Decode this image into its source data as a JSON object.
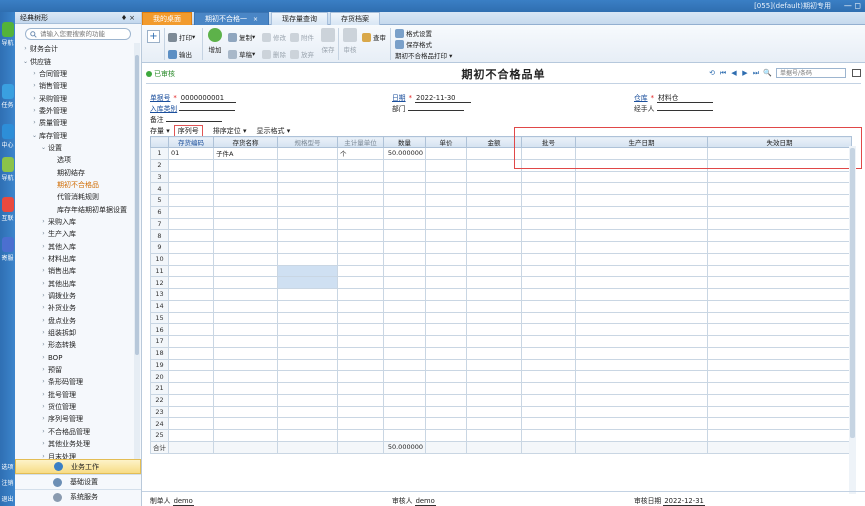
{
  "titlebar": {
    "title": "[055](default)期初专用",
    "controls": "— ◻"
  },
  "rail": [
    {
      "label": "导航",
      "color": "#53b33a"
    },
    {
      "label": "任务",
      "color": "#3aa0e0"
    },
    {
      "label": "中心",
      "color": "#2d8ed8"
    },
    {
      "label": "导航",
      "color": "#8bc34a"
    },
    {
      "label": "互联",
      "color": "#e94a3f"
    },
    {
      "label": "寄服",
      "color": "#4b6fd0"
    },
    {
      "label": "选项",
      "color": ""
    },
    {
      "label": "注销",
      "color": ""
    },
    {
      "label": "退出",
      "color": ""
    }
  ],
  "sidebar": {
    "title": "经典树形",
    "pin": "♦",
    "close": "×",
    "search_placeholder": "请输入您要搜索的功能",
    "tree": [
      {
        "label": "财务会计",
        "level": 0,
        "arrow": "›",
        "active": false
      },
      {
        "label": "供应链",
        "level": 0,
        "arrow": "⌄",
        "active": false
      },
      {
        "label": "合同管理",
        "level": 1,
        "arrow": "›",
        "active": false
      },
      {
        "label": "销售管理",
        "level": 1,
        "arrow": "›",
        "active": false
      },
      {
        "label": "采购管理",
        "level": 1,
        "arrow": "›",
        "active": false
      },
      {
        "label": "委外管理",
        "level": 1,
        "arrow": "›",
        "active": false
      },
      {
        "label": "质量管理",
        "level": 1,
        "arrow": "›",
        "active": false
      },
      {
        "label": "库存管理",
        "level": 1,
        "arrow": "⌄",
        "active": false
      },
      {
        "label": "设置",
        "level": 2,
        "arrow": "⌄",
        "active": false
      },
      {
        "label": "选项",
        "level": 3,
        "arrow": "",
        "active": false
      },
      {
        "label": "期初结存",
        "level": 3,
        "arrow": "",
        "active": false
      },
      {
        "label": "期初不合格品",
        "level": 3,
        "arrow": "",
        "active": true
      },
      {
        "label": "代管消耗规则",
        "level": 3,
        "arrow": "",
        "active": false
      },
      {
        "label": "库存年结期初单据设置",
        "level": 3,
        "arrow": "",
        "active": false
      },
      {
        "label": "采购入库",
        "level": 2,
        "arrow": "›",
        "active": false
      },
      {
        "label": "生产入库",
        "level": 2,
        "arrow": "›",
        "active": false
      },
      {
        "label": "其他入库",
        "level": 2,
        "arrow": "›",
        "active": false
      },
      {
        "label": "材料出库",
        "level": 2,
        "arrow": "›",
        "active": false
      },
      {
        "label": "销售出库",
        "level": 2,
        "arrow": "›",
        "active": false
      },
      {
        "label": "其他出库",
        "level": 2,
        "arrow": "›",
        "active": false
      },
      {
        "label": "调拨业务",
        "level": 2,
        "arrow": "›",
        "active": false
      },
      {
        "label": "补货业务",
        "level": 2,
        "arrow": "›",
        "active": false
      },
      {
        "label": "盘点业务",
        "level": 2,
        "arrow": "›",
        "active": false
      },
      {
        "label": "组装拆卸",
        "level": 2,
        "arrow": "›",
        "active": false
      },
      {
        "label": "形态转换",
        "level": 2,
        "arrow": "›",
        "active": false
      },
      {
        "label": "BOP",
        "level": 2,
        "arrow": "›",
        "active": false
      },
      {
        "label": "预留",
        "level": 2,
        "arrow": "›",
        "active": false
      },
      {
        "label": "条形码管理",
        "level": 2,
        "arrow": "›",
        "active": false
      },
      {
        "label": "批号管理",
        "level": 2,
        "arrow": "›",
        "active": false
      },
      {
        "label": "货位管理",
        "level": 2,
        "arrow": "›",
        "active": false
      },
      {
        "label": "序列号管理",
        "level": 2,
        "arrow": "›",
        "active": false
      },
      {
        "label": "不合格品管理",
        "level": 2,
        "arrow": "›",
        "active": false
      },
      {
        "label": "其他业务处理",
        "level": 2,
        "arrow": "›",
        "active": false
      },
      {
        "label": "月末处理",
        "level": 2,
        "arrow": "›",
        "active": false
      }
    ],
    "bottom": [
      {
        "label": "业务工作",
        "selected": true,
        "color": "#3a7fc5"
      },
      {
        "label": "基础设置",
        "selected": false,
        "color": "#6c8fb5"
      },
      {
        "label": "系统服务",
        "selected": false,
        "color": "#8a9bb0"
      }
    ]
  },
  "tabs": [
    {
      "label": "我的桌面",
      "type": "home",
      "close": ""
    },
    {
      "label": "期初不合格一",
      "type": "cur",
      "close": "×"
    },
    {
      "label": "现存量查询",
      "type": "",
      "close": ""
    },
    {
      "label": "存货档案",
      "type": "",
      "close": ""
    }
  ],
  "toolbar": {
    "add": "+",
    "print": "打印",
    "output": "输出",
    "new": "增加",
    "copy": "复制",
    "draft": "草稿",
    "modify": "修改",
    "delete": "删除",
    "attach": "附件",
    "discard": "放弃",
    "save": "保存",
    "audit": "审核",
    "query": "查审",
    "format_settings": "格式设置",
    "save_format": "保存格式",
    "print_menu": "期初不合格品打印 ▾"
  },
  "doc": {
    "status": "已审核",
    "title": "期初不合格品单",
    "search_placeholder": "单据号/条码",
    "nav": [
      "⟲",
      "⏮",
      "◀",
      "▶",
      "⏭",
      "🔍"
    ],
    "fields": {
      "doc_no_label": "单据号",
      "doc_no": "0000000001",
      "date_label": "日期",
      "date": "2022-11-30",
      "warehouse_label": "仓库",
      "warehouse": "材料仓",
      "in_type_label": "入库类别",
      "in_type": "",
      "dept_label": "部门",
      "dept": "",
      "handler_label": "经手人",
      "handler": "",
      "remark_label": "备注",
      "remark": ""
    },
    "grid_bar": [
      "存量 ▾",
      "序列号",
      "排序定位 ▾",
      "显示格式 ▾"
    ],
    "columns": [
      "",
      "存货编码",
      "存货名称",
      "规格型号",
      "主计量单位",
      "数量",
      "单价",
      "金额",
      "批号",
      "生产日期",
      "失效日期"
    ],
    "rows": [
      {
        "no": "1",
        "code": "01",
        "name": "子件A",
        "spec": "",
        "unit": "个",
        "qty": "50.000000",
        "price": "",
        "amount": "",
        "batch": "",
        "mfg": "",
        "exp": ""
      }
    ],
    "row_numbers": [
      "2",
      "3",
      "4",
      "5",
      "6",
      "7",
      "8",
      "9",
      "10",
      "11",
      "12",
      "13",
      "14",
      "15",
      "16",
      "17",
      "18",
      "19",
      "20",
      "21",
      "22",
      "23",
      "24",
      "25"
    ],
    "total_label": "合计",
    "total_qty": "50.000000"
  },
  "footer": {
    "maker_label": "制单人",
    "maker": "demo",
    "auditor_label": "审核人",
    "auditor": "demo",
    "audit_date_label": "审核日期",
    "audit_date": "2022-12-31"
  }
}
